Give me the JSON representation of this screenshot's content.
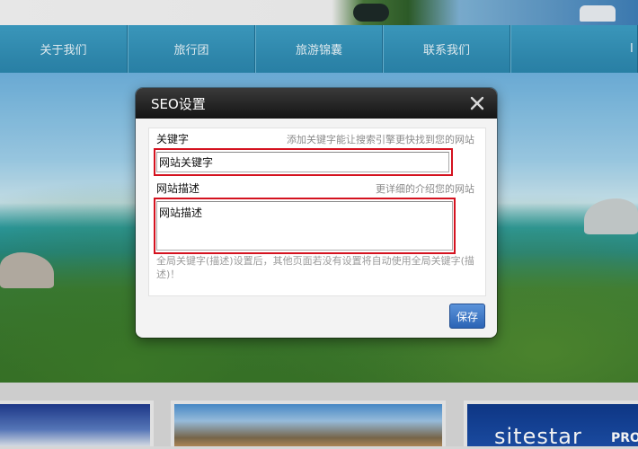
{
  "nav": {
    "items": [
      "关于我们",
      "旅行团",
      "旅游锦囊",
      "联系我们"
    ],
    "partial_item": "I"
  },
  "footer_thumbs": {
    "brand": "sitestar",
    "brand_sub": "PRO"
  },
  "dialog": {
    "title": "SEO设置",
    "close_icon": "close-icon",
    "keyword": {
      "label": "关键字",
      "hint": "添加关键字能让搜索引擎更快找到您的网站",
      "value": "网站关键字"
    },
    "description": {
      "label": "网站描述",
      "hint": "更详细的介绍您的网站",
      "value": "网站描述"
    },
    "note": "全局关键字(描述)设置后，其他页面若没有设置将自动使用全局关键字(描述)！",
    "save_label": "保存"
  },
  "colors": {
    "nav_bg": "#2b86ad",
    "dialog_header": "#1c1c1c",
    "highlight_border": "#d4121f",
    "save_button": "#3a74c6"
  }
}
